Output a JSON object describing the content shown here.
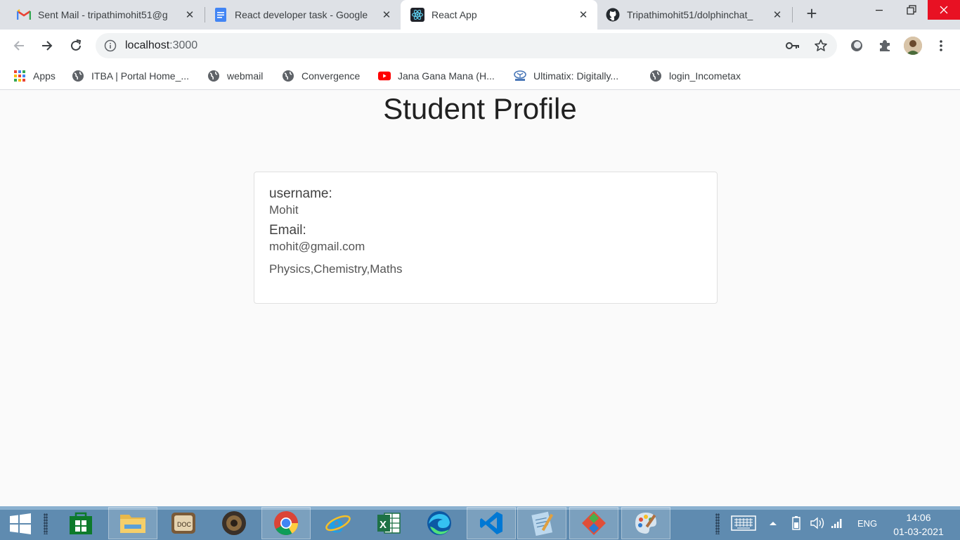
{
  "browser": {
    "tabs": [
      {
        "title": "Sent Mail - tripathimohit51@g",
        "icon": "gmail-icon",
        "active": false
      },
      {
        "title": "React developer task - Google",
        "icon": "google-docs-icon",
        "active": false
      },
      {
        "title": "React App",
        "icon": "react-icon",
        "active": true
      },
      {
        "title": "Tripathimohit51/dolphinchat_",
        "icon": "github-icon",
        "active": false
      }
    ],
    "new_tab_label": "+",
    "address": {
      "host": "localhost",
      "port": ":3000"
    },
    "bookmarks": [
      {
        "label": "Apps",
        "icon": "apps-grid-icon"
      },
      {
        "label": "ITBA | Portal Home_...",
        "icon": "globe-icon"
      },
      {
        "label": "webmail",
        "icon": "globe-icon"
      },
      {
        "label": "Convergence",
        "icon": "globe-icon"
      },
      {
        "label": "Jana Gana Mana (H...",
        "icon": "youtube-icon"
      },
      {
        "label": "Ultimatix: Digitally...",
        "icon": "tata-icon"
      },
      {
        "label": "login_Incometax",
        "icon": "globe-icon"
      }
    ]
  },
  "profile": {
    "heading": "Student Profile",
    "username_label": "username:",
    "username": "Mohit",
    "email_label": "Email:",
    "email": "mohit@gmail.com",
    "subjects": "Physics,Chemistry,Maths"
  },
  "taskbar": {
    "apps": [
      "store-icon",
      "file-explorer-icon",
      "doc-viewer-icon",
      "speaker-app-icon",
      "chrome-icon",
      "internet-explorer-icon",
      "excel-icon",
      "edge-icon",
      "vscode-icon",
      "notepad-icon",
      "git-icon",
      "paint-icon"
    ],
    "language": "ENG",
    "time": "14:06",
    "date": "01-03-2021"
  },
  "colors": {
    "accent_tab_bg": "#dee1e6",
    "page_bg": "#fafafa",
    "taskbar_bg": "#5f8bb0",
    "close_red": "#e81123"
  }
}
